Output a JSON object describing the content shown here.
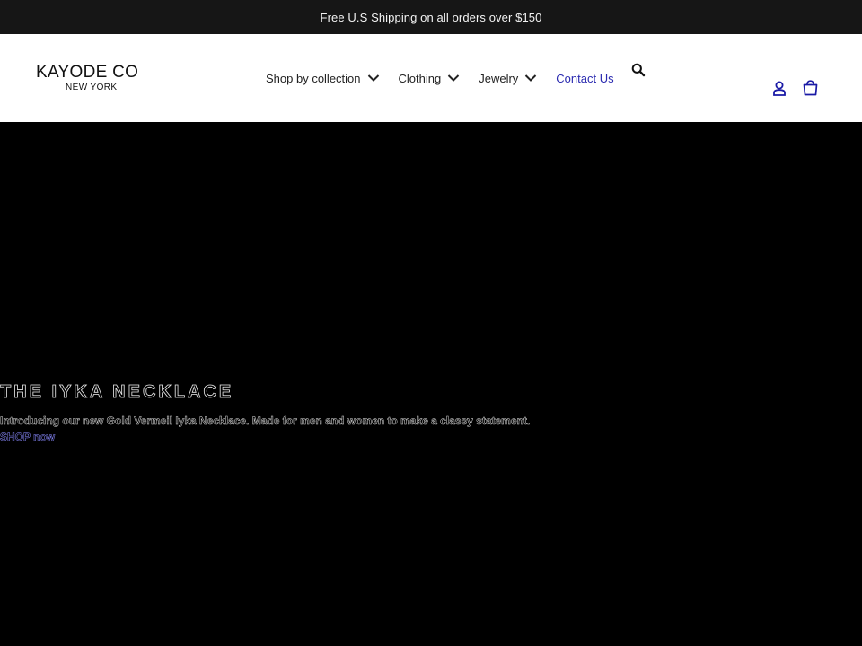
{
  "announcement": {
    "text": "Free U.S Shipping on all orders over $150"
  },
  "logo": {
    "main": "KAYODE CO",
    "sub": "NEW YORK"
  },
  "nav": {
    "items": [
      {
        "label": "Shop by collection"
      },
      {
        "label": "Clothing"
      },
      {
        "label": "Jewelry"
      },
      {
        "label": "Contact Us"
      }
    ]
  },
  "icons": {
    "search": "search-icon",
    "account": "account-icon",
    "cart": "cart-icon",
    "chevron": "chevron-down-icon"
  },
  "colors": {
    "announcement_bg": "#161616",
    "header_bg": "#ffffff",
    "hero_bg": "#000000",
    "link": "#2a2ab0"
  },
  "hero": {
    "title": "THE IYKA NECKLACE",
    "text": "Introducing our new Gold Vermeil Iyka Necklace. Made for men and women to make a classy statement.",
    "link": "SHOP now"
  }
}
